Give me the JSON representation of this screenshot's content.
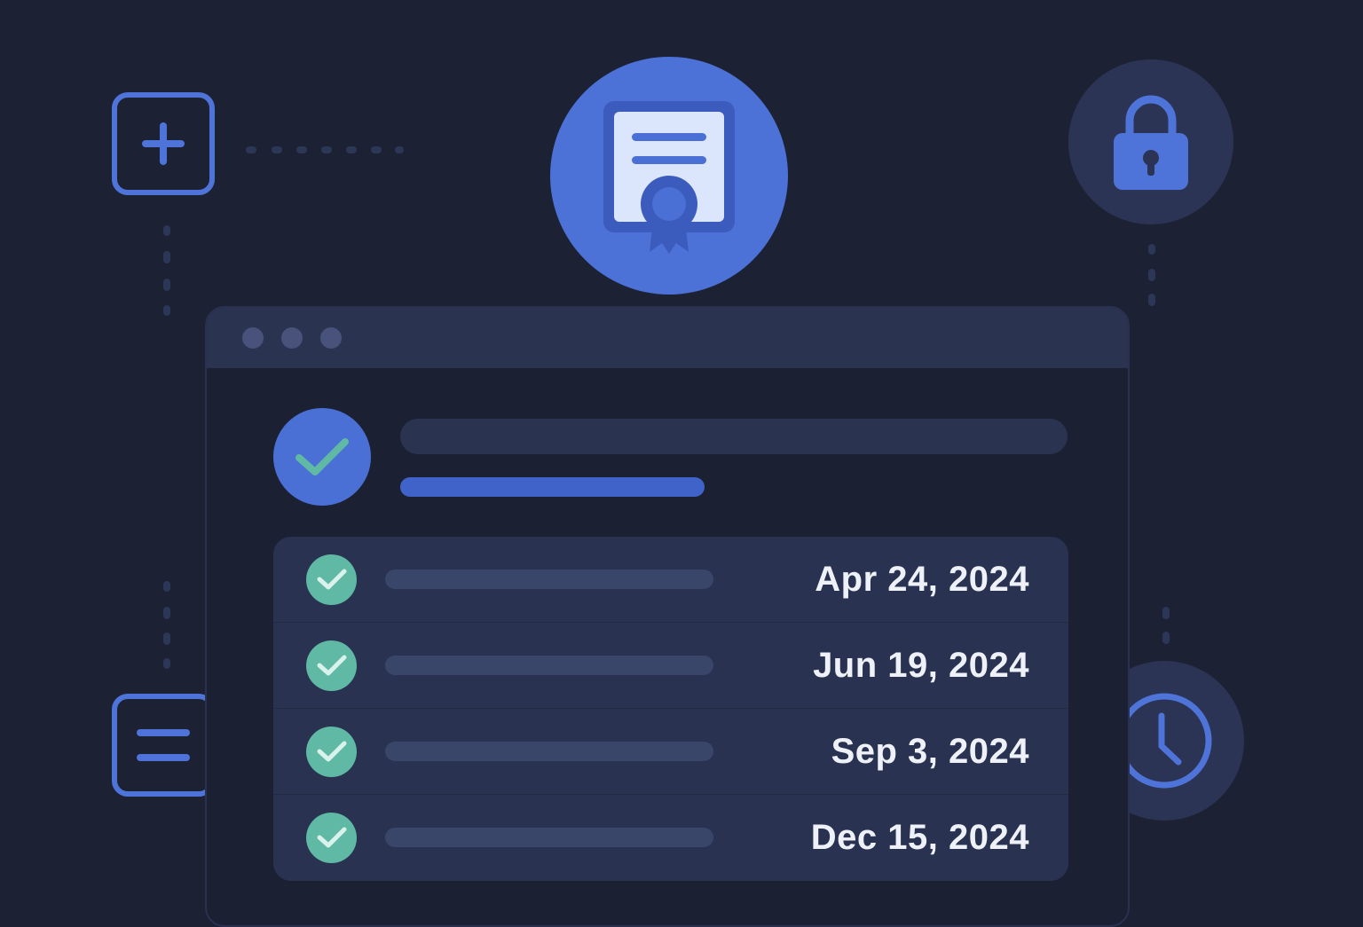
{
  "colors": {
    "background": "#1c2133",
    "accent_blue": "#4f74d9",
    "panel": "#293250",
    "success_teal": "#5fb9a4"
  },
  "icons": {
    "top_left": "plus-icon",
    "bottom_left": "menu-lines-icon",
    "top_center": "certificate-icon",
    "top_right": "lock-icon",
    "bottom_right": "clock-icon",
    "header_status": "check-icon"
  },
  "records": [
    {
      "date": "Apr 24, 2024"
    },
    {
      "date": "Jun 19, 2024"
    },
    {
      "date": "Sep 3, 2024"
    },
    {
      "date": "Dec 15, 2024"
    }
  ]
}
